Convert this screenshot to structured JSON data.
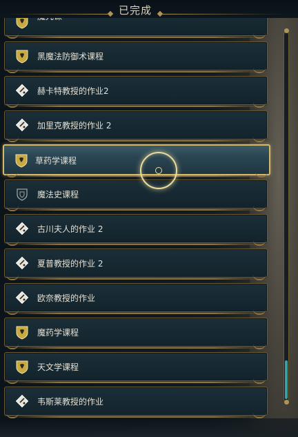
{
  "header": {
    "title": "已完成"
  },
  "items": [
    {
      "label": "魔咒课",
      "icon": "crest-icon"
    },
    {
      "label": "黑魔法防御术课程",
      "icon": "crest-icon"
    },
    {
      "label": "赫卡特教授的作业2",
      "icon": "assignment-icon"
    },
    {
      "label": "加里克教授的作业 2",
      "icon": "assignment-icon"
    },
    {
      "label": "草药学课程",
      "icon": "crest-icon",
      "selected": true
    },
    {
      "label": "魔法史课程",
      "icon": "shield-outline-icon"
    },
    {
      "label": "古川夫人的作业 2",
      "icon": "assignment-icon"
    },
    {
      "label": "夏普教授的作业 2",
      "icon": "assignment-icon"
    },
    {
      "label": "欧奈教授的作业",
      "icon": "assignment-icon"
    },
    {
      "label": "魔药学课程",
      "icon": "crest-icon"
    },
    {
      "label": "天文学课程",
      "icon": "crest-icon"
    },
    {
      "label": "韦斯莱教授的作业",
      "icon": "assignment-icon"
    }
  ],
  "scroll": {
    "position_fraction": 0.9
  },
  "colors": {
    "accent_gold": "#b09456",
    "scroll_thumb": "#3aa0a0"
  }
}
